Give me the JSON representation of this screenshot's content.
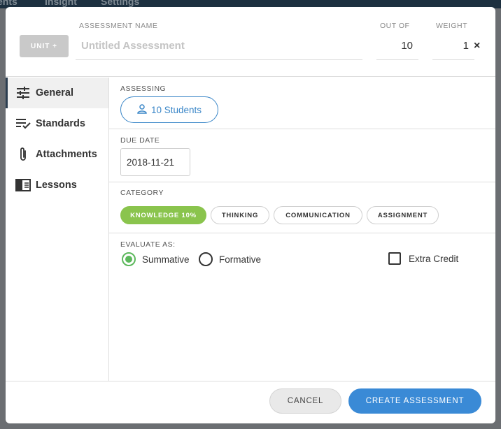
{
  "background": {
    "nav_items": [
      "ents",
      "Insight",
      "Settings"
    ]
  },
  "header": {
    "unit_label": "UNIT +",
    "assessment_name_label": "ASSESSMENT NAME",
    "assessment_name_placeholder": "Untitled Assessment",
    "out_of_label": "OUT OF",
    "out_of_value": "10",
    "weight_label": "WEIGHT",
    "weight_value": "1",
    "close_glyph": "×"
  },
  "sidebar": {
    "items": [
      {
        "label": "General",
        "icon": "sliders-icon",
        "active": true
      },
      {
        "label": "Standards",
        "icon": "checklist-icon",
        "active": false
      },
      {
        "label": "Attachments",
        "icon": "paperclip-icon",
        "active": false
      },
      {
        "label": "Lessons",
        "icon": "book-icon",
        "active": false
      }
    ]
  },
  "assessing": {
    "label": "ASSESSING",
    "students_button": "10 Students"
  },
  "due_date": {
    "label": "DUE DATE",
    "value": "2018-11-21"
  },
  "category": {
    "label": "CATEGORY",
    "options": [
      {
        "label": "KNOWLEDGE 10%",
        "active": true
      },
      {
        "label": "THINKING",
        "active": false
      },
      {
        "label": "COMMUNICATION",
        "active": false
      },
      {
        "label": "ASSIGNMENT",
        "active": false
      }
    ]
  },
  "evaluate": {
    "label": "EVALUATE AS:",
    "summative": "Summative",
    "formative": "Formative",
    "extra_credit": "Extra Credit",
    "selected": "Summative"
  },
  "footer": {
    "cancel_label": "CANCEL",
    "create_label": "CREATE ASSESSMENT"
  },
  "colors": {
    "accent_blue": "#3a8ad6",
    "category_active_green": "#8ac44d",
    "radio_selected_green": "#5cb85c"
  }
}
